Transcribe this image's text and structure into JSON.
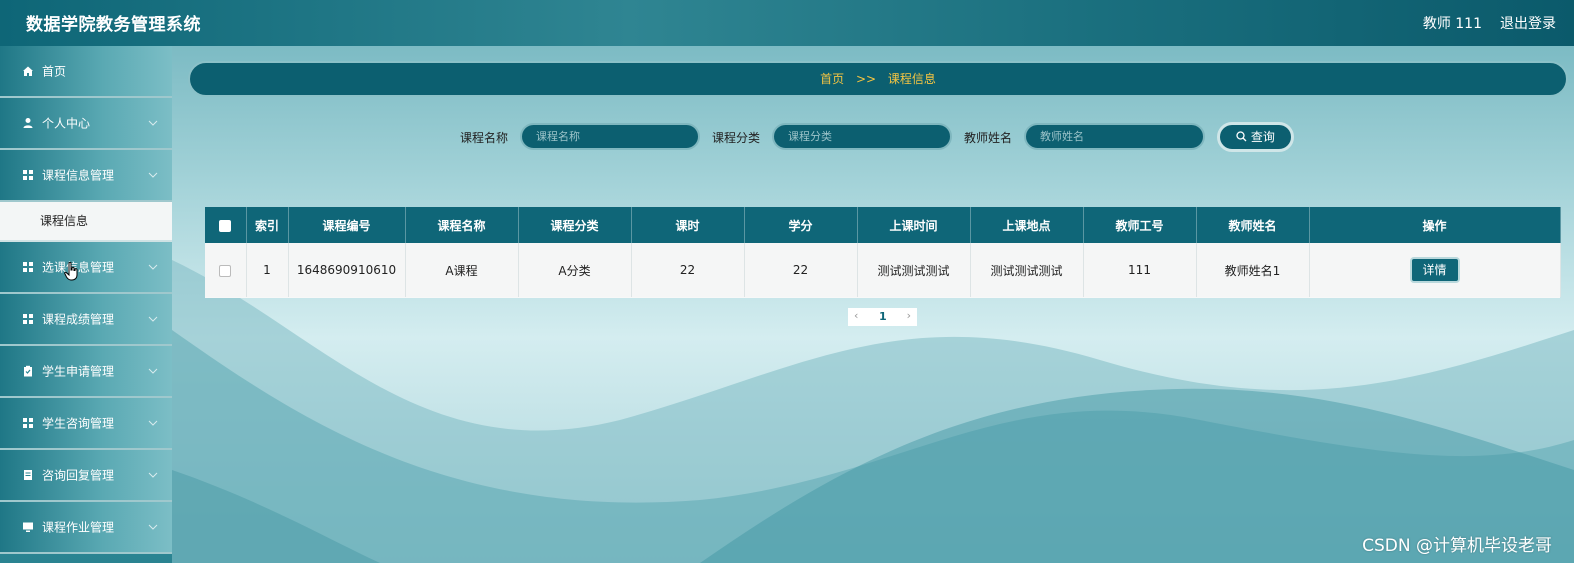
{
  "app": {
    "title": "数据学院教务管理系统",
    "user_label": "教师 111",
    "logout_label": "退出登录"
  },
  "sidebar": {
    "items": [
      {
        "label": "首页",
        "icon": "home-icon"
      },
      {
        "label": "个人中心",
        "icon": "user-icon"
      },
      {
        "label": "课程信息管理",
        "icon": "grid-icon"
      },
      {
        "label": "选课信息管理",
        "icon": "grid-icon"
      },
      {
        "label": "课程成绩管理",
        "icon": "grid-icon"
      },
      {
        "label": "学生申请管理",
        "icon": "clipboard-icon"
      },
      {
        "label": "学生咨询管理",
        "icon": "grid-icon"
      },
      {
        "label": "咨询回复管理",
        "icon": "document-icon"
      },
      {
        "label": "课程作业管理",
        "icon": "monitor-icon"
      }
    ],
    "subitem": "课程信息"
  },
  "breadcrumb": {
    "home": "首页",
    "sep": ">>",
    "current": "课程信息"
  },
  "search": {
    "fields": [
      {
        "label": "课程名称",
        "placeholder": "课程名称"
      },
      {
        "label": "课程分类",
        "placeholder": "课程分类"
      },
      {
        "label": "教师姓名",
        "placeholder": "教师姓名"
      }
    ],
    "button_label": "查询"
  },
  "table": {
    "headers": [
      "索引",
      "课程编号",
      "课程名称",
      "课程分类",
      "课时",
      "学分",
      "上课时间",
      "上课地点",
      "教师工号",
      "教师姓名",
      "操作"
    ],
    "rows": [
      {
        "index": "1",
        "course_no": "1648690910610",
        "course_name": "A课程",
        "category": "A分类",
        "hours": "22",
        "credits": "22",
        "time": "测试测试测试",
        "location": "测试测试测试",
        "teacher_no": "111",
        "teacher_name": "教师姓名1",
        "action_label": "详情"
      }
    ]
  },
  "pagination": {
    "prev": "‹",
    "current_page": "1",
    "next": "›"
  },
  "watermark": "CSDN @计算机毕设老哥",
  "colors": {
    "primary": "#0f6678",
    "accent_text": "#f5c542"
  }
}
